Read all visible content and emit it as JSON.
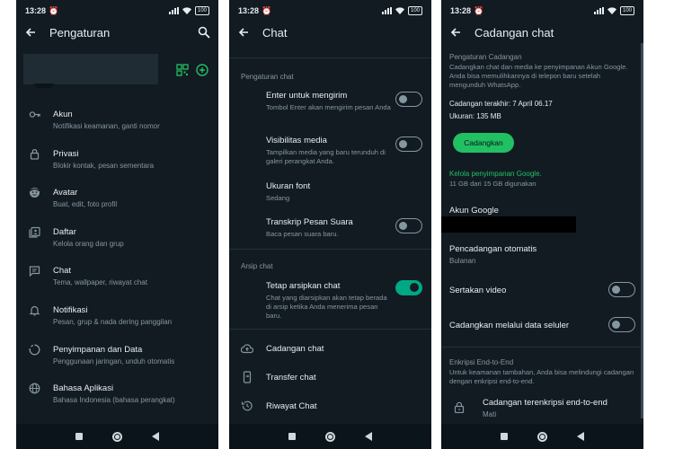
{
  "status_bar": {
    "time": "13:28",
    "battery": "100"
  },
  "screen1": {
    "title": "Pengaturan",
    "items": [
      {
        "title": "Akun",
        "subtitle": "Notifikasi keamanan, ganti nomor",
        "icon": "key-icon"
      },
      {
        "title": "Privasi",
        "subtitle": "Blokir kontak, pesan sementara",
        "icon": "lock-icon"
      },
      {
        "title": "Avatar",
        "subtitle": "Buat, edit, foto profil",
        "icon": "avatar-icon"
      },
      {
        "title": "Daftar",
        "subtitle": "Kelola orang dan grup",
        "icon": "list-icon"
      },
      {
        "title": "Chat",
        "subtitle": "Tema, wallpaper, riwayat chat",
        "icon": "chat-icon"
      },
      {
        "title": "Notifikasi",
        "subtitle": "Pesan, grup & nada dering panggilan",
        "icon": "bell-icon"
      },
      {
        "title": "Penyimpanan dan Data",
        "subtitle": "Penggunaan jaringan, unduh otomatis",
        "icon": "storage-icon"
      },
      {
        "title": "Bahasa Aplikasi",
        "subtitle": "Bahasa Indonesia (bahasa perangkat)",
        "icon": "globe-icon"
      }
    ]
  },
  "screen2": {
    "title": "Chat",
    "section_settings": "Pengaturan chat",
    "enter_send": {
      "title": "Enter untuk mengirim",
      "subtitle": "Tombol Enter akan mengirim pesan Anda",
      "on": false
    },
    "media_visibility": {
      "title": "Visibilitas media",
      "subtitle": "Tampilkan media yang baru terunduh di galeri perangkat Anda.",
      "on": false
    },
    "font_size": {
      "title": "Ukuran font",
      "subtitle": "Sedang"
    },
    "voice_transcript": {
      "title": "Transkrip Pesan Suara",
      "subtitle": "Baca pesan suara baru.",
      "on": false
    },
    "section_archive": "Arsip chat",
    "keep_archived": {
      "title": "Tetap arsipkan chat",
      "subtitle": "Chat yang diarsipkan akan tetap berada di arsip ketika Anda menerima pesan baru.",
      "on": true
    },
    "backup": "Cadangan chat",
    "transfer": "Transfer chat",
    "history": "Riwayat Chat"
  },
  "screen3": {
    "title": "Cadangan chat",
    "section_backup_settings": "Pengaturan Cadangan",
    "backup_desc": "Cadangkan chat dan media ke penyimpanan Akun Google. Anda bisa memulihkannya di telepon baru setelah mengunduh WhatsApp.",
    "last_backup": "Cadangan terakhir: 7 April 06.17",
    "size": "Ukuran: 135 MB",
    "backup_button": "Cadangkan",
    "manage_storage": "Kelola penyimpanan Google.",
    "storage_used": "11 GB dari 15 GB digunakan",
    "google_account_label": "Akun Google",
    "auto_backup_label": "Pencadangan otomatis",
    "auto_backup_value": "Bulanan",
    "include_video": {
      "label": "Sertakan video",
      "on": false
    },
    "cellular_backup": {
      "label": "Cadangkan melalui data seluler",
      "on": false
    },
    "section_e2e": "Enkripsi End-to-End",
    "e2e_desc": "Untuk keamanan tambahan, Anda bisa melindungi cadangan dengan enkripsi end-to-end.",
    "e2e_backup": {
      "title": "Cadangan terenkripsi end-to-end",
      "subtitle": "Mati"
    }
  },
  "colors": {
    "background": "#121b22",
    "accent": "#00a884",
    "button": "#21c063",
    "link": "#21c063"
  }
}
